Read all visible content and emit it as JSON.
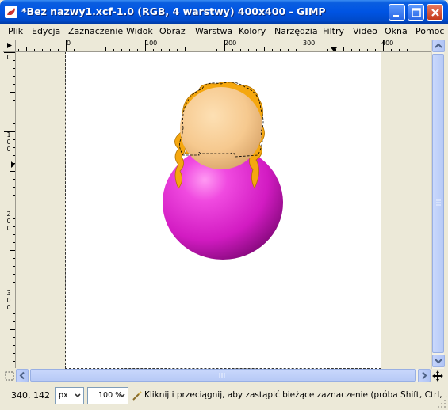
{
  "window": {
    "title": "*Bez nazwy1.xcf-1.0 (RGB, 4 warstwy) 400x400 - GIMP"
  },
  "menu": {
    "items": [
      {
        "label": "Plik",
        "key": "plik"
      },
      {
        "label": "Edycja",
        "key": "edycja"
      },
      {
        "label": "Zaznaczenie",
        "key": "zaznaczenie"
      },
      {
        "label": "Widok",
        "key": "widok"
      },
      {
        "label": "Obraz",
        "key": "obraz"
      },
      {
        "label": "Warstwa",
        "key": "warstwa"
      },
      {
        "label": "Kolory",
        "key": "kolory"
      },
      {
        "label": "Narzędzia",
        "key": "narzedzia"
      },
      {
        "label": "Filtry",
        "key": "filtry"
      },
      {
        "label": "Video",
        "key": "video"
      },
      {
        "label": "Okna",
        "key": "okna"
      },
      {
        "label": "Pomoc",
        "key": "pomoc"
      }
    ]
  },
  "rulers": {
    "horizontal_labels": [
      "0",
      "100",
      "200",
      "300",
      "400"
    ],
    "vertical_labels": [
      "0",
      "100",
      "200",
      "300"
    ]
  },
  "canvas": {
    "colors": {
      "face": "#f6c98f",
      "hair": "#f5a70f",
      "body": "#e62ad1",
      "page": "#ffffff",
      "background": "#ece9d8"
    }
  },
  "statusbar": {
    "coords": "340, 142",
    "unit": "px",
    "zoom": "100 %",
    "message": "Kliknij i przeciągnij, aby zastąpić bieżące zaznaczenie (próba Shift, Ctrl, ..."
  },
  "icons": [
    "gimp-app-icon",
    "minimize-icon",
    "maximize-icon",
    "close-icon",
    "quick-mask-icon",
    "navigate-icon",
    "menu-arrow-icon",
    "hint-icon"
  ]
}
